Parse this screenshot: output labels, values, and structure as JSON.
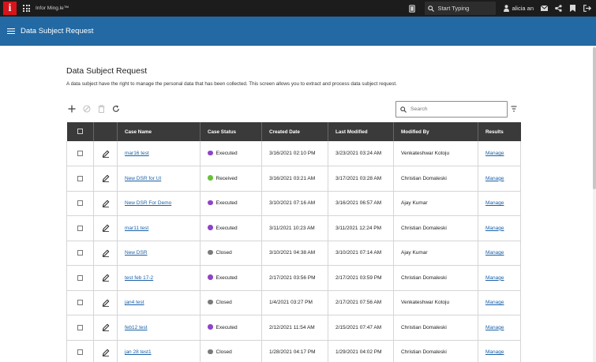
{
  "topbar": {
    "logo_letter": "i",
    "app_name": "Infor Ming.le™",
    "search_placeholder": "Start Typing",
    "user_name": "alicia an"
  },
  "header": {
    "title": "Data Subject Request"
  },
  "page": {
    "title": "Data Subject Request",
    "description": "A data subject have the right to manage the personal data that has been collected. This screen allows you to extract and process data subject request."
  },
  "toolbar": {
    "search_placeholder": "Search"
  },
  "status_colors": {
    "Executed": "#8e44c8",
    "Received": "#67c23a",
    "Closed": "#7a7a7a"
  },
  "table": {
    "columns": [
      "",
      "",
      "Case Name",
      "Case Status",
      "Created Date",
      "Last Modified",
      "Modified By",
      "Results"
    ],
    "rows": [
      {
        "case_name": "mar16 test",
        "status": "Executed",
        "created": "3/16/2021 02:10 PM",
        "modified": "3/23/2021 03:24 AM",
        "modified_by": "Venkateshwar Kotoju",
        "result": "Manage"
      },
      {
        "case_name": "New DSR for UI",
        "status": "Received",
        "created": "3/16/2021 03:21 AM",
        "modified": "3/17/2021 03:28 AM",
        "modified_by": "Christian Domaleski",
        "result": "Manage"
      },
      {
        "case_name": "New DSR For Demo",
        "status": "Executed",
        "created": "3/10/2021 07:16 AM",
        "modified": "3/16/2021 06:57 AM",
        "modified_by": "Ajay Kumar",
        "result": "Manage"
      },
      {
        "case_name": "mar11 test",
        "status": "Executed",
        "created": "3/11/2021 10:23 AM",
        "modified": "3/11/2021 12:24 PM",
        "modified_by": "Christian Domaleski",
        "result": "Manage"
      },
      {
        "case_name": "New DSR",
        "status": "Closed",
        "created": "3/10/2021 04:38 AM",
        "modified": "3/10/2021 07:14 AM",
        "modified_by": "Ajay Kumar",
        "result": "Manage"
      },
      {
        "case_name": "test feb 17-2",
        "status": "Executed",
        "created": "2/17/2021 03:56 PM",
        "modified": "2/17/2021 03:59 PM",
        "modified_by": "Christian Domaleski",
        "result": "Manage"
      },
      {
        "case_name": "jan4 test",
        "status": "Closed",
        "created": "1/4/2021 03:27 PM",
        "modified": "2/17/2021 07:56 AM",
        "modified_by": "Venkateshwar Kotoju",
        "result": "Manage"
      },
      {
        "case_name": "feb12 test",
        "status": "Executed",
        "created": "2/12/2021 11:54 AM",
        "modified": "2/15/2021 07:47 AM",
        "modified_by": "Christian Domaleski",
        "result": "Manage"
      },
      {
        "case_name": "jan 28 test1",
        "status": "Closed",
        "created": "1/28/2021 04:17 PM",
        "modified": "1/29/2021 04:02 PM",
        "modified_by": "Christian Domaleski",
        "result": "Manage"
      }
    ]
  }
}
